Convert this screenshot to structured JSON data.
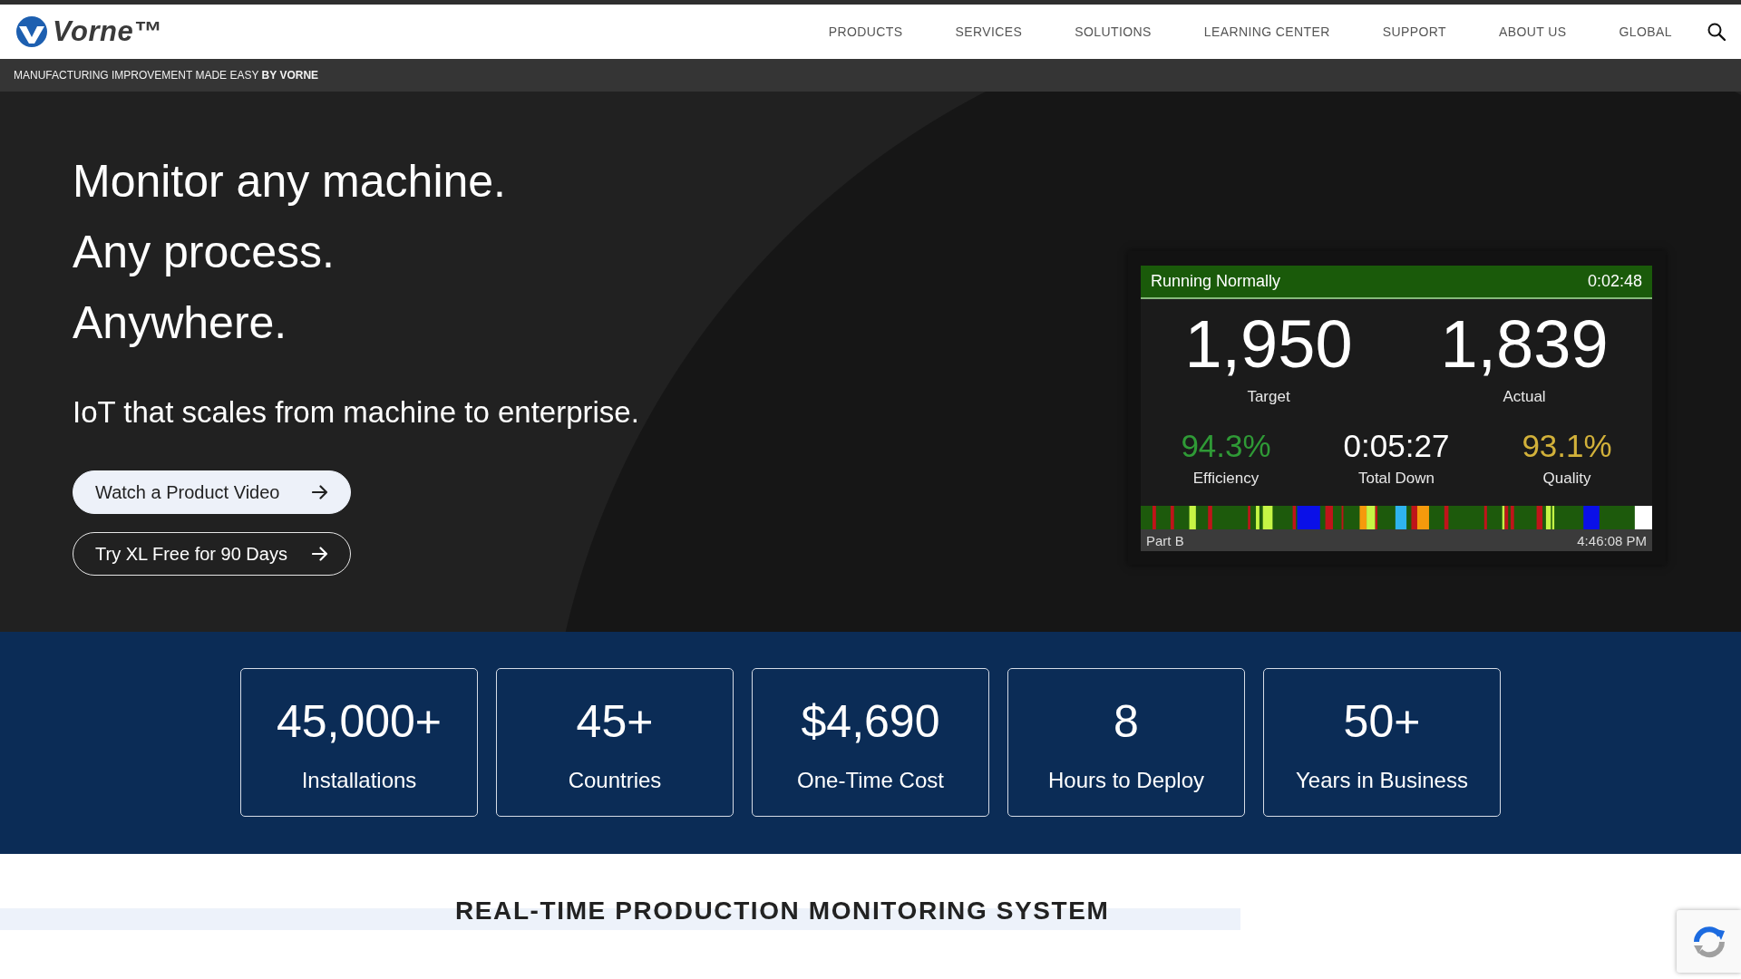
{
  "header": {
    "logo": "Vorne™",
    "nav": [
      "PRODUCTS",
      "SERVICES",
      "SOLUTIONS",
      "LEARNING CENTER",
      "SUPPORT",
      "ABOUT US",
      "GLOBAL"
    ]
  },
  "tagline": "MANUFACTURING IMPROVEMENT MADE EASY **BY VORNE**",
  "hero": {
    "headline": [
      "Monitor any machine.",
      "Any process.",
      "Anywhere."
    ],
    "subtitle": "IoT that scales from machine to enterprise.",
    "buttons": [
      {
        "label": "Watch a Product Video",
        "kind": "filled"
      },
      {
        "label": "Try XL Free for 90 Days",
        "kind": "outline"
      }
    ]
  },
  "display": {
    "status": "Running Normally",
    "timer": "0:02:48",
    "counts": [
      {
        "value": "1,950",
        "label": "Target"
      },
      {
        "value": "1,839",
        "label": "Actual"
      }
    ],
    "metrics": [
      {
        "value": "94.3%",
        "label": "Efficiency",
        "color": "#2f9a36"
      },
      {
        "value": "0:05:27",
        "label": "Total Down",
        "color": "#ffffff"
      },
      {
        "value": "93.1%",
        "label": "Quality",
        "color": "#d2b13a"
      }
    ],
    "part": "Part B",
    "clock": "4:46:08 PM"
  },
  "stats": [
    {
      "value": "45,000+",
      "label": "Installations"
    },
    {
      "value": "45+",
      "label": "Countries"
    },
    {
      "value": "$4,690",
      "label": "One-Time Cost"
    },
    {
      "value": "8",
      "label": "Hours to Deploy"
    },
    {
      "value": "50+",
      "label": "Years in Business"
    }
  ],
  "section": {
    "heading": "REAL-TIME PRODUCTION MONITORING SYSTEM"
  }
}
